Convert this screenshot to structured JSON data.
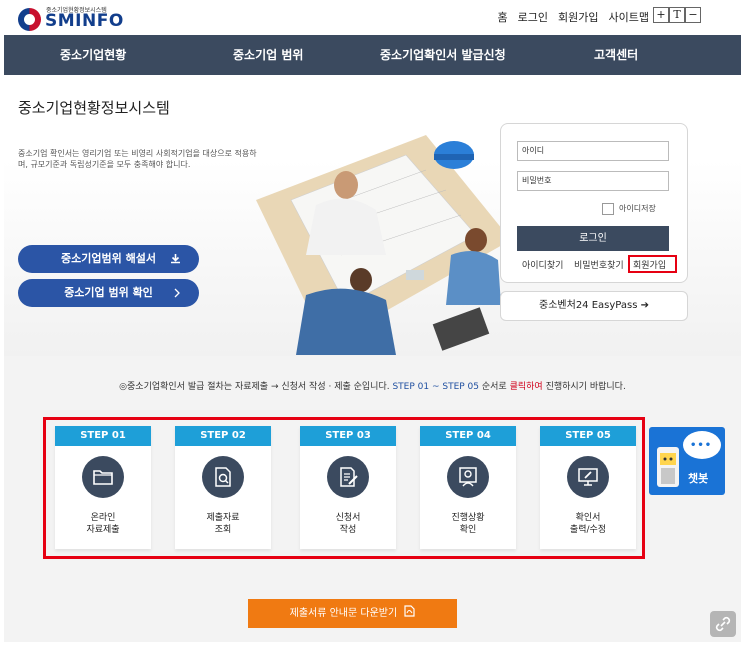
{
  "header": {
    "logo_sub": "중소기업현황정보시스템",
    "logo_main": "SMINFO",
    "util_links": [
      "홈",
      "로그인",
      "회원가입",
      "사이트맵"
    ],
    "font_controls": [
      "+",
      "T",
      "−"
    ]
  },
  "nav": {
    "items": [
      "중소기업현황",
      "중소기업 범위",
      "중소기업확인서 발급신청",
      "고객센터"
    ]
  },
  "hero": {
    "title": "중소기업현황정보시스템",
    "description": "중소기업 확인서는 영리기업 또는 비영리 사회적기업을 대상으로 적용하며, 규모기준과 독립성기준을 모두 충족해야 합니다.",
    "buttons": [
      {
        "label": "중소기업범위 해설서",
        "icon": "download-icon"
      },
      {
        "label": "중소기업 범위 확인",
        "icon": "chevron-right-icon"
      }
    ]
  },
  "login": {
    "id_placeholder": "아이디",
    "pw_placeholder": "비밀번호",
    "save_id_label": "아이디저장",
    "login_button": "로그인",
    "links": [
      "아이디찾기",
      "비밀번호찾기",
      "회원가입"
    ],
    "easypass_label": "중소벤처24 EasyPass ➔"
  },
  "steps": {
    "guide_prefix": "◎중소기업확인서 발급 절차는 자료제출 → 신청서 작성 · 제출 순입니다. ",
    "guide_blue": "STEP 01 ~ STEP 05",
    "guide_mid": " 순서로 ",
    "guide_red": "클릭하여",
    "guide_suffix": " 진행하시기 바랍니다.",
    "items": [
      {
        "tab": "STEP 01",
        "line1": "온라인",
        "line2": "자료제출",
        "icon": "folder-icon"
      },
      {
        "tab": "STEP 02",
        "line1": "제출자료",
        "line2": "조회",
        "icon": "document-search-icon"
      },
      {
        "tab": "STEP 03",
        "line1": "신청서",
        "line2": "작성",
        "icon": "write-document-icon"
      },
      {
        "tab": "STEP 04",
        "line1": "진행상황",
        "line2": "확인",
        "icon": "progress-check-icon"
      },
      {
        "tab": "STEP 05",
        "line1": "확인서",
        "line2": "출력/수정",
        "icon": "print-edit-icon"
      }
    ]
  },
  "chatbot": {
    "label": "챗봇"
  },
  "download": {
    "label": "제출서류 안내문 다운받기"
  },
  "colors": {
    "nav_bg": "#3b4a5f",
    "pill_bg": "#2b55a6",
    "step_tab": "#1e9fd8",
    "highlight": "#e60012",
    "download_bg": "#f07a12",
    "chatbot_bg": "#1a73d6"
  }
}
